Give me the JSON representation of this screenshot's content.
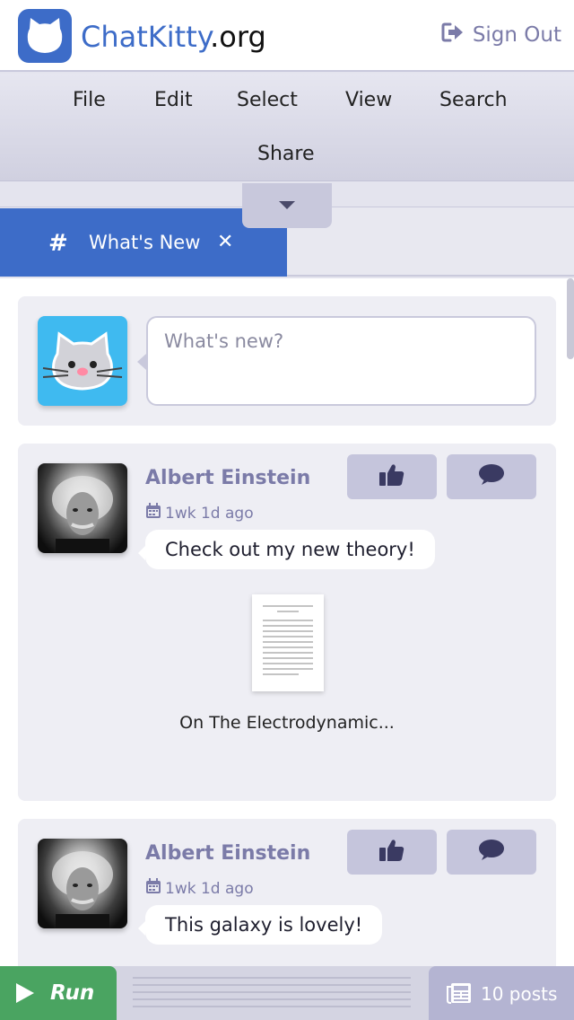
{
  "header": {
    "logo_icon": "cat-face-icon",
    "brand_main": "ChatKitty",
    "brand_suffix": ".org",
    "signout_icon": "sign-out-icon",
    "signout_label": "Sign Out"
  },
  "menu": {
    "items": [
      "File",
      "Edit",
      "Select",
      "View",
      "Search",
      "Share"
    ],
    "toggle_icon": "caret-down-icon"
  },
  "tabs": [
    {
      "icon": "hash-icon",
      "label": "What's New",
      "close_icon": "close-icon"
    }
  ],
  "compose": {
    "avatar_icon": "cat-avatar-icon",
    "placeholder": "What's new?"
  },
  "posts": [
    {
      "author": "Albert Einstein",
      "time_icon": "calendar-icon",
      "time": "1wk 1d ago",
      "message": "Check out my new theory!",
      "attachment_name": "On The Electrodynamic...",
      "like_icon": "thumbs-up-icon",
      "comment_icon": "comment-icon"
    },
    {
      "author": "Albert Einstein",
      "time_icon": "calendar-icon",
      "time": "1wk 1d ago",
      "message": "This galaxy is lovely!",
      "like_icon": "thumbs-up-icon",
      "comment_icon": "comment-icon"
    }
  ],
  "footer": {
    "run_icon": "play-icon",
    "run_label": "Run",
    "posts_icon": "newspaper-icon",
    "posts_label": "10 posts"
  },
  "colors": {
    "brand": "#3d6cc8",
    "accent_muted": "#7b7ba8",
    "run": "#4aa461",
    "posts": "#b4b4d2"
  }
}
